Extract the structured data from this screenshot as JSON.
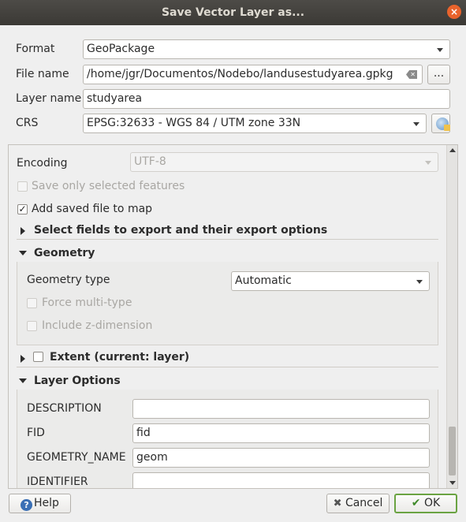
{
  "window": {
    "title": "Save Vector Layer as...",
    "close_symbol": "×"
  },
  "form": {
    "format_label": "Format",
    "format_value": "GeoPackage",
    "filename_label": "File name",
    "filename_value": "/home/jgr/Documentos/Nodebo/landusestudyarea.gpkg",
    "browse_label": "...",
    "layername_label": "Layer name",
    "layername_value": "studyarea",
    "crs_label": "CRS",
    "crs_value": "EPSG:32633 - WGS 84 / UTM zone 33N"
  },
  "options": {
    "encoding_label": "Encoding",
    "encoding_value": "UTF-8",
    "save_selected_label": "Save only selected features",
    "save_selected_checked": false,
    "add_to_map_label": "Add saved file to map",
    "add_to_map_checked": true,
    "check_mark": "✓",
    "select_fields_label": "Select fields to export and their export options",
    "geometry_section_label": "Geometry",
    "geometry_type_label": "Geometry type",
    "geometry_type_value": "Automatic",
    "force_multi_label": "Force multi-type",
    "include_z_label": "Include z-dimension",
    "extent_label": "Extent (current: layer)",
    "layer_options_label": "Layer Options",
    "layer_options": [
      {
        "name": "DESCRIPTION",
        "value": ""
      },
      {
        "name": "FID",
        "value": "fid"
      },
      {
        "name": "GEOMETRY_NAME",
        "value": "geom"
      },
      {
        "name": "IDENTIFIER",
        "value": ""
      }
    ]
  },
  "buttons": {
    "help_label": "Help",
    "help_icon": "?",
    "cancel_label": "Cancel",
    "cancel_icon": "✖",
    "ok_label": "OK",
    "ok_icon": "✔"
  },
  "icons": {
    "clear": "backspace-clear-icon",
    "crs": "projection-selector-icon"
  },
  "colors": {
    "accent_ok_border": "#6aa342",
    "titlebar": "#3d3b37",
    "close": "#e9632c"
  }
}
